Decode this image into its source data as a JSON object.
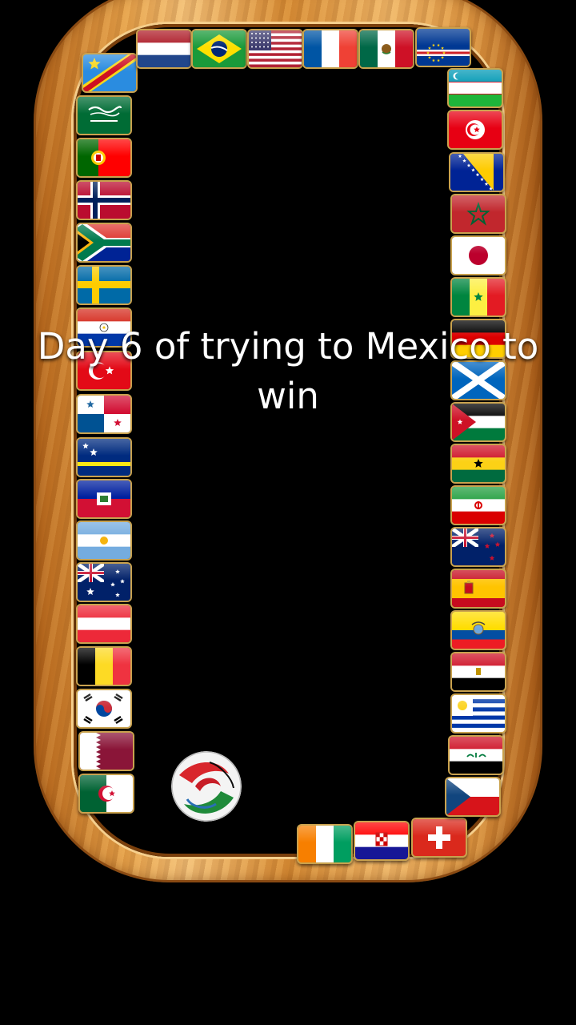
{
  "caption": "Day 6 of trying to Mexico to win",
  "ball": {
    "icon": "soccer-ball-icon"
  },
  "tiles": [
    {
      "country": "DR Congo",
      "icon": "flag-dr-congo-icon"
    },
    {
      "country": "Netherlands",
      "icon": "flag-netherlands-icon"
    },
    {
      "country": "Brazil",
      "icon": "flag-brazil-icon"
    },
    {
      "country": "United States",
      "icon": "flag-usa-icon"
    },
    {
      "country": "France",
      "icon": "flag-france-icon"
    },
    {
      "country": "Mexico",
      "icon": "flag-mexico-icon"
    },
    {
      "country": "Cape Verde",
      "icon": "flag-cape-verde-icon"
    },
    {
      "country": "Saudi Arabia",
      "icon": "flag-saudi-arabia-icon"
    },
    {
      "country": "Portugal",
      "icon": "flag-portugal-icon"
    },
    {
      "country": "Norway",
      "icon": "flag-norway-icon"
    },
    {
      "country": "South Africa",
      "icon": "flag-south-africa-icon"
    },
    {
      "country": "Sweden",
      "icon": "flag-sweden-icon"
    },
    {
      "country": "Paraguay",
      "icon": "flag-paraguay-icon"
    },
    {
      "country": "Turkey",
      "icon": "flag-turkey-icon"
    },
    {
      "country": "Panama",
      "icon": "flag-panama-icon"
    },
    {
      "country": "Curacao",
      "icon": "flag-curacao-icon"
    },
    {
      "country": "Haiti",
      "icon": "flag-haiti-icon"
    },
    {
      "country": "Argentina",
      "icon": "flag-argentina-icon"
    },
    {
      "country": "Australia",
      "icon": "flag-australia-icon"
    },
    {
      "country": "Austria",
      "icon": "flag-austria-icon"
    },
    {
      "country": "Belgium",
      "icon": "flag-belgium-icon"
    },
    {
      "country": "South Korea",
      "icon": "flag-south-korea-icon"
    },
    {
      "country": "Qatar",
      "icon": "flag-qatar-icon"
    },
    {
      "country": "Algeria",
      "icon": "flag-algeria-icon"
    },
    {
      "country": "Ivory Coast",
      "icon": "flag-ivory-coast-icon"
    },
    {
      "country": "Croatia",
      "icon": "flag-croatia-icon"
    },
    {
      "country": "Switzerland",
      "icon": "flag-switzerland-icon"
    },
    {
      "country": "Uzbekistan",
      "icon": "flag-uzbekistan-icon"
    },
    {
      "country": "Tunisia",
      "icon": "flag-tunisia-icon"
    },
    {
      "country": "Bosnia and Herzegovina",
      "icon": "flag-bosnia-icon"
    },
    {
      "country": "Morocco",
      "icon": "flag-morocco-icon"
    },
    {
      "country": "Japan",
      "icon": "flag-japan-icon"
    },
    {
      "country": "Senegal",
      "icon": "flag-senegal-icon"
    },
    {
      "country": "Germany",
      "icon": "flag-germany-icon"
    },
    {
      "country": "Scotland",
      "icon": "flag-scotland-icon"
    },
    {
      "country": "Jordan",
      "icon": "flag-jordan-icon"
    },
    {
      "country": "Ghana",
      "icon": "flag-ghana-icon"
    },
    {
      "country": "Iran",
      "icon": "flag-iran-icon"
    },
    {
      "country": "New Zealand",
      "icon": "flag-new-zealand-icon"
    },
    {
      "country": "Spain",
      "icon": "flag-spain-icon"
    },
    {
      "country": "Ecuador",
      "icon": "flag-ecuador-icon"
    },
    {
      "country": "Egypt",
      "icon": "flag-egypt-icon"
    },
    {
      "country": "Uruguay",
      "icon": "flag-uruguay-icon"
    },
    {
      "country": "Iraq",
      "icon": "flag-iraq-icon"
    },
    {
      "country": "Czech Republic",
      "icon": "flag-czech-republic-icon"
    }
  ]
}
